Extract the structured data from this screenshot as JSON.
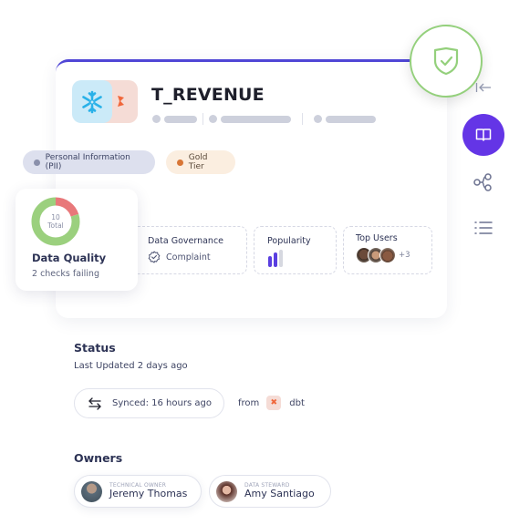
{
  "asset": {
    "title": "T_REVENUE",
    "source_icons": [
      "snowflake-icon",
      "dbt-icon"
    ]
  },
  "verified_badge": {
    "icon": "shield-check-icon",
    "color": "#94d07c"
  },
  "sidebar": {
    "items": [
      {
        "icon": "collapse-left-icon",
        "active": false
      },
      {
        "icon": "book-icon",
        "active": true
      },
      {
        "icon": "lineage-icon",
        "active": false
      },
      {
        "icon": "list-icon",
        "active": false
      }
    ],
    "accent": "#6435e6"
  },
  "tags": [
    {
      "label": "Personal Information (PII)",
      "dot_color": "#8a90ab"
    },
    {
      "label": "Gold Tier",
      "dot_color": "#d87636"
    }
  ],
  "data_quality": {
    "total": "10",
    "total_label": "Total",
    "title": "Data Quality",
    "subtitle": "2 checks failing",
    "passing": 8,
    "failing": 2,
    "pass_color": "#9bd07e",
    "fail_color": "#e8787a"
  },
  "stats": {
    "governance": {
      "label": "Data Governance",
      "value": "Complaint"
    },
    "popularity": {
      "label": "Popularity",
      "level": 2,
      "max": 3
    },
    "top_users": {
      "label": "Top Users",
      "more": "+3"
    }
  },
  "status": {
    "title": "Status",
    "last_updated": "Last Updated 2 days ago",
    "synced": "Synced: 16 hours ago",
    "from_label": "from",
    "source": "dbt"
  },
  "owners": {
    "title": "Owners",
    "list": [
      {
        "role": "TECHNICAL OWNER",
        "name": "Jeremy Thomas"
      },
      {
        "role": "DATA STEWARD",
        "name": "Amy Santiago"
      }
    ]
  }
}
